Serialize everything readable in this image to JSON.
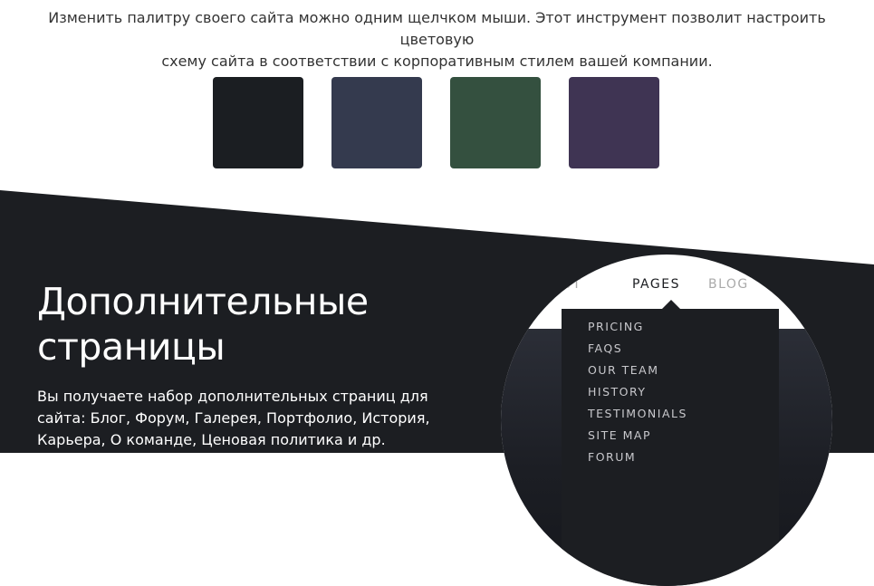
{
  "intro": {
    "line1": "Изменить палитру своего сайта можно одним щелчком мыши. Этот инструмент позволит настроить цветовую",
    "line2": "схему сайта в соответствии с корпоративным стилем вашей компании."
  },
  "swatches": [
    {
      "color": "#1b1e22"
    },
    {
      "color": "#343a4e"
    },
    {
      "color": "#34503f"
    },
    {
      "color": "#3f3453"
    }
  ],
  "section": {
    "background": "#1c1e22",
    "title_line1": "Дополнительные",
    "title_line2": "страницы",
    "description": "Вы получаете набор дополнительных страниц для сайта: Блог, Форум, Галерея, Портфолио, История, Карьера, О команде, Ценовая политика и др."
  },
  "preview": {
    "nav": {
      "about": "OUT",
      "pages": "PAGES",
      "blog": "BLOG"
    },
    "dropdown": [
      "PRICING",
      "FAQS",
      "OUR TEAM",
      "HISTORY",
      "TESTIMONIALS",
      "SITE MAP",
      "FORUM"
    ]
  }
}
